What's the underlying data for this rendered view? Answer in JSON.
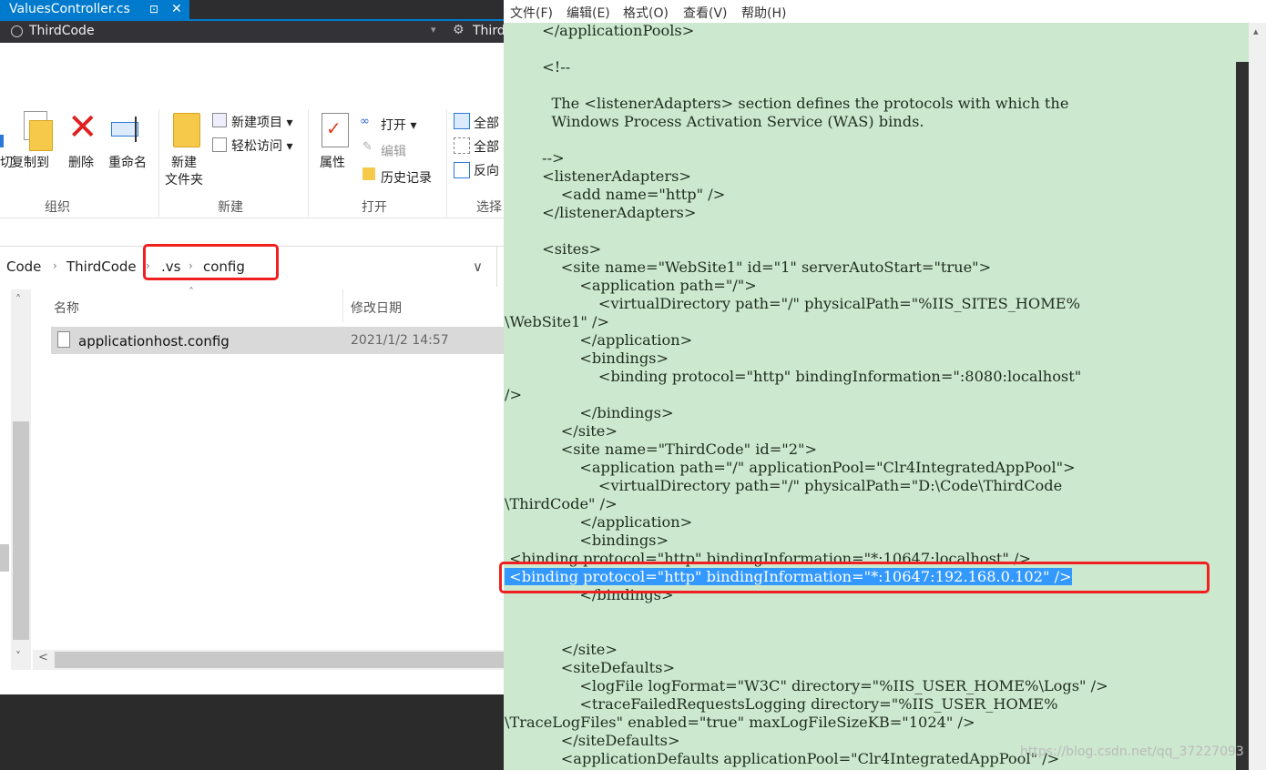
{
  "vs": {
    "tab_title": "ValuesController.cs",
    "tab_pin": "⊡",
    "tab_close": "✕",
    "project": "ThirdCode",
    "project2": "Third",
    "dropdown": "▾"
  },
  "ribbon": {
    "copy_to": "复制到",
    "delete": "删除",
    "rename": "重命名",
    "group_organize": "组织",
    "new_folder_1": "新建",
    "new_folder_2": "文件夹",
    "new_item": "新建项目 ▾",
    "easy_access": "轻松访问 ▾",
    "group_new": "新建",
    "properties": "属性",
    "open": "打开 ▾",
    "edit": "编辑",
    "history": "历史记录",
    "group_open": "打开",
    "select_all": "全部",
    "select_none": "全部",
    "invert": "反向",
    "group_select": "选择",
    "cut_stub": "切"
  },
  "address": {
    "crumbs": [
      "Code",
      "ThirdCode",
      ".vs",
      "config"
    ],
    "sep": "›",
    "dropdown": "∨"
  },
  "files": {
    "col_name": "名称",
    "col_date": "修改日期",
    "sort_arrow": "˄",
    "rows": [
      {
        "name": "applicationhost.config",
        "date": "2021/1/2 14:57"
      }
    ]
  },
  "notepad": {
    "menu": [
      "文件(F)",
      "编辑(E)",
      "格式(O)",
      "查看(V)",
      "帮助(H)"
    ],
    "lines": [
      "        </applicationPools>",
      "",
      "        <!--",
      "",
      "          The <listenerAdapters> section defines the protocols with which the",
      "          Windows Process Activation Service (WAS) binds.",
      "",
      "        -->",
      "        <listenerAdapters>",
      "            <add name=\"http\" />",
      "        </listenerAdapters>",
      "",
      "        <sites>",
      "            <site name=\"WebSite1\" id=\"1\" serverAutoStart=\"true\">",
      "                <application path=\"/\">",
      "                    <virtualDirectory path=\"/\" physicalPath=\"%IIS_SITES_HOME%",
      "\\WebSite1\" />",
      "                </application>",
      "                <bindings>",
      "                    <binding protocol=\"http\" bindingInformation=\":8080:localhost\"",
      "/>",
      "                </bindings>",
      "            </site>",
      "            <site name=\"ThirdCode\" id=\"2\">",
      "                <application path=\"/\" applicationPool=\"Clr4IntegratedAppPool\">",
      "                    <virtualDirectory path=\"/\" physicalPath=\"D:\\Code\\ThirdCode",
      "\\ThirdCode\" />",
      "                </application>",
      "                <bindings>",
      " <binding protocol=\"http\" bindingInformation=\"*:10647:localhost\" />",
      " <binding protocol=\"http\" bindingInformation=\"*:10647:192.168.0.102\" />",
      "                </bindings>",
      "",
      "",
      "            </site>",
      "            <siteDefaults>",
      "                <logFile logFormat=\"W3C\" directory=\"%IIS_USER_HOME%\\Logs\" />",
      "                <traceFailedRequestsLogging directory=\"%IIS_USER_HOME%",
      "\\TraceLogFiles\" enabled=\"true\" maxLogFileSizeKB=\"1024\" />",
      "            </siteDefaults>",
      "            <applicationDefaults applicationPool=\"Clr4IntegratedAppPool\" />"
    ],
    "highlighted_line_index": 30,
    "scroll_up": "▴"
  },
  "watermark": "https://blog.csdn.net/qq_37227093",
  "colors": {
    "vs_accent": "#007acc",
    "editor_bg": "#cce8cf",
    "selection": "#3399ff",
    "annotation_red": "#f02020"
  }
}
